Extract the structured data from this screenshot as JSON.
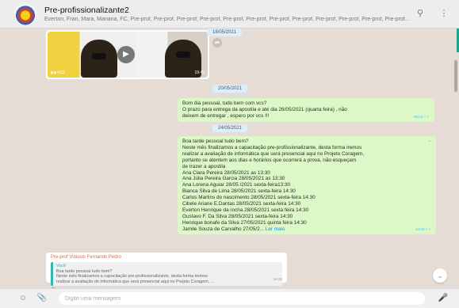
{
  "header": {
    "title": "Pre-profissionalizante2",
    "members": "Everton, Fran, Mara, Mariana, FC, Pre-prof, Pre-prof, Pre-prof, Pre-prof, Pre-prof, Pre-prof, Pre-prof, Pre-prof, Pre-prof, Pre-prof, Pre-prof, Pre-prof..."
  },
  "icons": {
    "search": "search-icon",
    "menu": "menu-icon"
  },
  "video": {
    "badge": "▮◀ 4:53",
    "time": "19:45"
  },
  "dates": {
    "d1": "18/05/2021",
    "d2": "20/05/2021",
    "d3": "24/05/2021"
  },
  "msg1": {
    "lines": [
      "Bom dia pessoal, tudo bem com vcs?",
      "O prazo para entrega da apostila e até dia 26/05/2021 (quarta feira) , não",
      "deixem de entregar , espero por vcs !!!"
    ],
    "time": "09:24 ✓✓"
  },
  "msg2": {
    "lines": [
      "Boa tarde pessoal tudo bem?",
      "Neste mês finalizamos a capacitação pre-profissionalizante, desta forma iremos",
      "realizar a avaliação de informática que será presencial aqui no Projeto Coragem,",
      "portanto se atentem aos dias e horários que ocorrerá a prova, não esqueçam",
      "de trazer a apostila",
      "Ana Clara Pereira 28/05/2021 as 13:30",
      "Ana Júlia Pereira Garcia 28/05/2021 as 13:30",
      "Ana Lorena Aguiar 28/05 /2021 sexta-feira13:30",
      "Bianca Silva de Lima 28/05/2021 sexta-feira 14:30",
      "Carlos Martins do nascimento 28/05/2021 sexta-feira 14:30",
      "Cibele Ariane E.Dantas 28/05/2021 sexta-feira 14:30",
      "Everton Henrique da rocha 28/05/2021 sexta feira 14:30",
      "Gustavo F. Da Silva 28/05/2021 sexta-feira 14:30",
      "Henrique bonafe da Silva 27/05/2021 quinta feira 14:30"
    ],
    "last_line": "Jamile Souza de Carvalho 27/05/2...",
    "read_more": "Ler mais",
    "time": "14:04 ✓✓"
  },
  "msg3": {
    "sender": "Pre-prof Vinicius Fernando Pedro",
    "quote_author": "Você",
    "quote_lines": [
      "Boa tarde pessoal tudo bem?",
      "Neste mês finalizamos a capacitação pre-profissionalizante, desta forma iremos",
      "realizar a avaliação de informática que será presencial aqui no Projeto Coragem, ..."
    ],
    "body": "Ok",
    "time": "16:25"
  },
  "composer": {
    "placeholder": "Digite uma mensagem"
  }
}
